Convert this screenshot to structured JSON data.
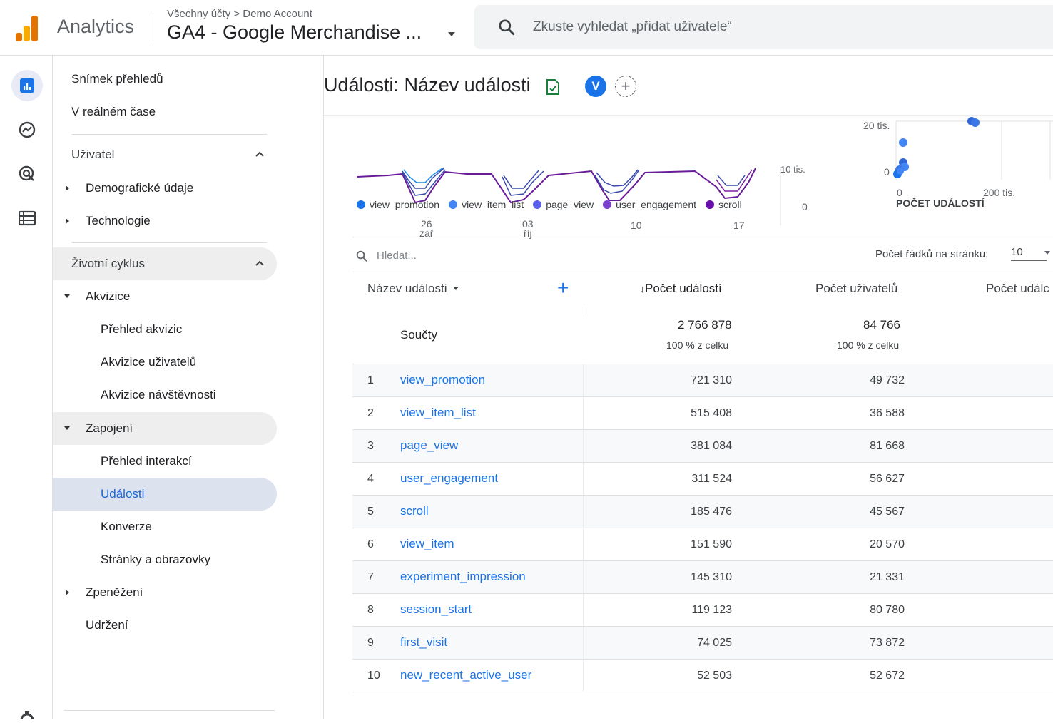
{
  "header": {
    "app_name": "Analytics",
    "breadcrumb": "Všechny účty > Demo Account",
    "property": "GA4 - Google Merchandise ...",
    "search_placeholder": "Zkuste vyhledat „přidat uživatele“"
  },
  "rail": {
    "icons": [
      "reports-icon",
      "explore-icon",
      "advertising-icon",
      "configure-icon"
    ]
  },
  "nav": {
    "snapshot": "Snímek přehledů",
    "realtime": "V reálném čase",
    "user_section": "Uživatel",
    "demographics": "Demografické údaje",
    "tech": "Technologie",
    "lifecycle_section": "Životní cyklus",
    "acquisition": "Akvizice",
    "acq_overview": "Přehled akvizic",
    "user_acq": "Akvizice uživatelů",
    "traffic_acq": "Akvizice návštěvnosti",
    "engagement": "Zapojení",
    "eng_overview": "Přehled interakcí",
    "events": "Události",
    "conversions": "Konverze",
    "pages": "Stránky a obrazovky",
    "monetization": "Zpeněžení",
    "retention": "Udržení"
  },
  "page": {
    "title": "Události: Název události",
    "avatar_letter": "V"
  },
  "chart": {
    "x_ticks": [
      {
        "day": "26",
        "month": "zář"
      },
      {
        "day": "03",
        "month": "říj"
      },
      {
        "day": "10",
        "month": ""
      },
      {
        "day": "17",
        "month": ""
      }
    ],
    "y_ticks": [
      "10 tis.",
      "0"
    ],
    "legend": [
      {
        "name": "view_promotion",
        "color": "#1a73e8"
      },
      {
        "name": "view_item_list",
        "color": "#4285f4"
      },
      {
        "name": "page_view",
        "color": "#5b5ff0"
      },
      {
        "name": "user_engagement",
        "color": "#7b3fd0"
      },
      {
        "name": "scroll",
        "color": "#6a0dad"
      }
    ],
    "scatter": {
      "y_tick_top": "20 tis.",
      "y_tick_zero": "0",
      "x_tick_zero": "0",
      "x_tick_200": "200 tis.",
      "x_label": "POČET UDÁLOSTÍ"
    }
  },
  "table": {
    "search_placeholder": "Hledat...",
    "rows_per_page_label": "Počet řádků na stránku:",
    "rows_per_page_value": "10",
    "col_name": "Název události",
    "col_count": "Počet událostí",
    "col_users": "Počet uživatelů",
    "col_count_per_user": "Počet událc",
    "totals_label": "Součty",
    "total_count": "2 766 878",
    "total_count_pct": "100 % z celku",
    "total_users": "84 766",
    "total_users_pct": "100 % z celku",
    "rows": [
      {
        "idx": "1",
        "name": "view_promotion",
        "count": "721 310",
        "users": "49 732"
      },
      {
        "idx": "2",
        "name": "view_item_list",
        "count": "515 408",
        "users": "36 588"
      },
      {
        "idx": "3",
        "name": "page_view",
        "count": "381 084",
        "users": "81 668"
      },
      {
        "idx": "4",
        "name": "user_engagement",
        "count": "311 524",
        "users": "56 627"
      },
      {
        "idx": "5",
        "name": "scroll",
        "count": "185 476",
        "users": "45 567"
      },
      {
        "idx": "6",
        "name": "view_item",
        "count": "151 590",
        "users": "20 570"
      },
      {
        "idx": "7",
        "name": "experiment_impression",
        "count": "145 310",
        "users": "21 331"
      },
      {
        "idx": "8",
        "name": "session_start",
        "count": "119 123",
        "users": "80 780"
      },
      {
        "idx": "9",
        "name": "first_visit",
        "count": "74 025",
        "users": "73 872"
      },
      {
        "idx": "10",
        "name": "new_recent_active_user",
        "count": "52 503",
        "users": "52 672"
      }
    ]
  }
}
